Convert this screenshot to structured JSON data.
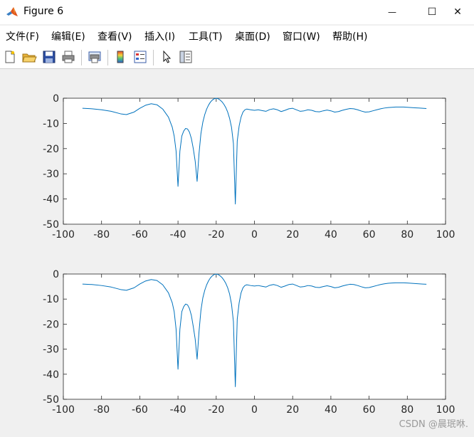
{
  "window": {
    "title": "Figure 6",
    "minimize_glyph": "—",
    "maximize_glyph": "☐",
    "close_glyph": "✕"
  },
  "menu": [
    "文件(F)",
    "编辑(E)",
    "查看(V)",
    "插入(I)",
    "工具(T)",
    "桌面(D)",
    "窗口(W)",
    "帮助(H)"
  ],
  "toolbar": {
    "icons": [
      "new-figure-icon",
      "open-file-icon",
      "save-icon",
      "print-icon",
      "print-preview-icon",
      "insert-colorbar-icon",
      "insert-legend-icon",
      "edit-plot-arrow-icon",
      "property-inspector-icon"
    ]
  },
  "watermark": "CSDN @晨珉咻.",
  "colors": {
    "line": "#0072BD",
    "axes_bg": "#ffffff",
    "figure_bg": "#f0f0f0",
    "axis": "#262626"
  },
  "chart_data": [
    {
      "type": "line",
      "xlim": [
        -100,
        100
      ],
      "ylim": [
        -50,
        0
      ],
      "xticks": [
        -100,
        -80,
        -60,
        -40,
        -20,
        0,
        20,
        40,
        60,
        80,
        100
      ],
      "yticks": [
        0,
        -10,
        -20,
        -30,
        -40,
        -50
      ],
      "grid": false,
      "series": [
        {
          "x": [
            -90,
            -85,
            -80,
            -75,
            -70,
            -67,
            -63,
            -60,
            -57,
            -54,
            -51,
            -48,
            -45,
            -43,
            -42,
            -41,
            -40,
            -39,
            -38,
            -37,
            -36,
            -35,
            -34,
            -33,
            -32,
            -31,
            -30,
            -29,
            -28,
            -27,
            -26,
            -25,
            -24,
            -23,
            -22,
            -21,
            -20,
            -19,
            -18,
            -17,
            -16,
            -15,
            -14,
            -13,
            -12,
            -11,
            -10,
            -9,
            -8,
            -7,
            -6,
            -5,
            -4,
            -2,
            0,
            2,
            4,
            6,
            8,
            10,
            12,
            14,
            16,
            18,
            20,
            22,
            24,
            26,
            28,
            30,
            32,
            34,
            36,
            38,
            40,
            42,
            44,
            46,
            48,
            50,
            52,
            54,
            56,
            58,
            60,
            62,
            64,
            66,
            68,
            70,
            72,
            74,
            76,
            78,
            80,
            82,
            84,
            86,
            88,
            90
          ],
          "y": [
            -4,
            -4.2,
            -4.6,
            -5.2,
            -6.2,
            -6.5,
            -5.5,
            -4.0,
            -2.8,
            -2.2,
            -2.6,
            -4.3,
            -7.5,
            -11.5,
            -15,
            -21,
            -35,
            -21,
            -15,
            -13,
            -12,
            -12.2,
            -13.5,
            -16,
            -20,
            -25,
            -33,
            -22,
            -14,
            -9.5,
            -6.5,
            -4.3,
            -2.7,
            -1.5,
            -0.7,
            -0.2,
            0,
            -0.2,
            -0.7,
            -1.4,
            -2.4,
            -3.7,
            -5.5,
            -8.0,
            -11.5,
            -18,
            -42,
            -17,
            -11,
            -7.5,
            -5.5,
            -4.6,
            -4.3,
            -4.6,
            -4.8,
            -4.6,
            -4.9,
            -5.2,
            -4.5,
            -4.2,
            -4.6,
            -5.3,
            -4.8,
            -4.2,
            -4.0,
            -4.6,
            -5.2,
            -5.0,
            -4.6,
            -4.8,
            -5.3,
            -5.4,
            -5.0,
            -4.7,
            -5.0,
            -5.5,
            -5.3,
            -4.8,
            -4.4,
            -4.1,
            -4.2,
            -4.6,
            -5.1,
            -5.5,
            -5.4,
            -5.0,
            -4.6,
            -4.2,
            -3.9,
            -3.7,
            -3.6,
            -3.5,
            -3.5,
            -3.5,
            -3.6,
            -3.7,
            -3.8,
            -3.9,
            -4.0,
            -4.1
          ]
        }
      ]
    },
    {
      "type": "line",
      "xlim": [
        -100,
        100
      ],
      "ylim": [
        -50,
        0
      ],
      "xticks": [
        -100,
        -80,
        -60,
        -40,
        -20,
        0,
        20,
        40,
        60,
        80,
        100
      ],
      "yticks": [
        0,
        -10,
        -20,
        -30,
        -40,
        -50
      ],
      "grid": false,
      "series": [
        {
          "x": [
            -90,
            -85,
            -80,
            -75,
            -70,
            -67,
            -63,
            -60,
            -57,
            -54,
            -51,
            -48,
            -45,
            -43,
            -42,
            -41,
            -40,
            -39,
            -38,
            -37,
            -36,
            -35,
            -34,
            -33,
            -32,
            -31,
            -30,
            -29,
            -28,
            -27,
            -26,
            -25,
            -24,
            -23,
            -22,
            -21,
            -20,
            -19,
            -18,
            -17,
            -16,
            -15,
            -14,
            -13,
            -12,
            -11,
            -10,
            -9,
            -8,
            -7,
            -6,
            -5,
            -4,
            -2,
            0,
            2,
            4,
            6,
            8,
            10,
            12,
            14,
            16,
            18,
            20,
            22,
            24,
            26,
            28,
            30,
            32,
            34,
            36,
            38,
            40,
            42,
            44,
            46,
            48,
            50,
            52,
            54,
            56,
            58,
            60,
            62,
            64,
            66,
            68,
            70,
            72,
            74,
            76,
            78,
            80,
            82,
            84,
            86,
            88,
            90
          ],
          "y": [
            -4,
            -4.2,
            -4.6,
            -5.2,
            -6.2,
            -6.5,
            -5.5,
            -4.0,
            -2.8,
            -2.2,
            -2.6,
            -4.3,
            -7.5,
            -11.5,
            -15,
            -22,
            -38,
            -22,
            -15,
            -13,
            -12,
            -12.3,
            -13.8,
            -16.5,
            -21,
            -26,
            -34,
            -23,
            -14.5,
            -9.5,
            -6.5,
            -4.3,
            -2.7,
            -1.5,
            -0.7,
            -0.2,
            0,
            -0.2,
            -0.7,
            -1.4,
            -2.4,
            -3.7,
            -5.5,
            -8.0,
            -12,
            -19,
            -45,
            -18,
            -11.5,
            -7.5,
            -5.5,
            -4.6,
            -4.3,
            -4.6,
            -4.8,
            -4.6,
            -4.9,
            -5.2,
            -4.5,
            -4.2,
            -4.6,
            -5.3,
            -4.8,
            -4.2,
            -4.0,
            -4.6,
            -5.2,
            -5.0,
            -4.6,
            -4.8,
            -5.3,
            -5.4,
            -5.0,
            -4.7,
            -5.0,
            -5.5,
            -5.3,
            -4.8,
            -4.4,
            -4.1,
            -4.2,
            -4.6,
            -5.1,
            -5.5,
            -5.4,
            -5.0,
            -4.6,
            -4.2,
            -3.9,
            -3.7,
            -3.6,
            -3.5,
            -3.5,
            -3.5,
            -3.6,
            -3.7,
            -3.8,
            -3.9,
            -4.0,
            -4.1
          ]
        }
      ]
    }
  ]
}
